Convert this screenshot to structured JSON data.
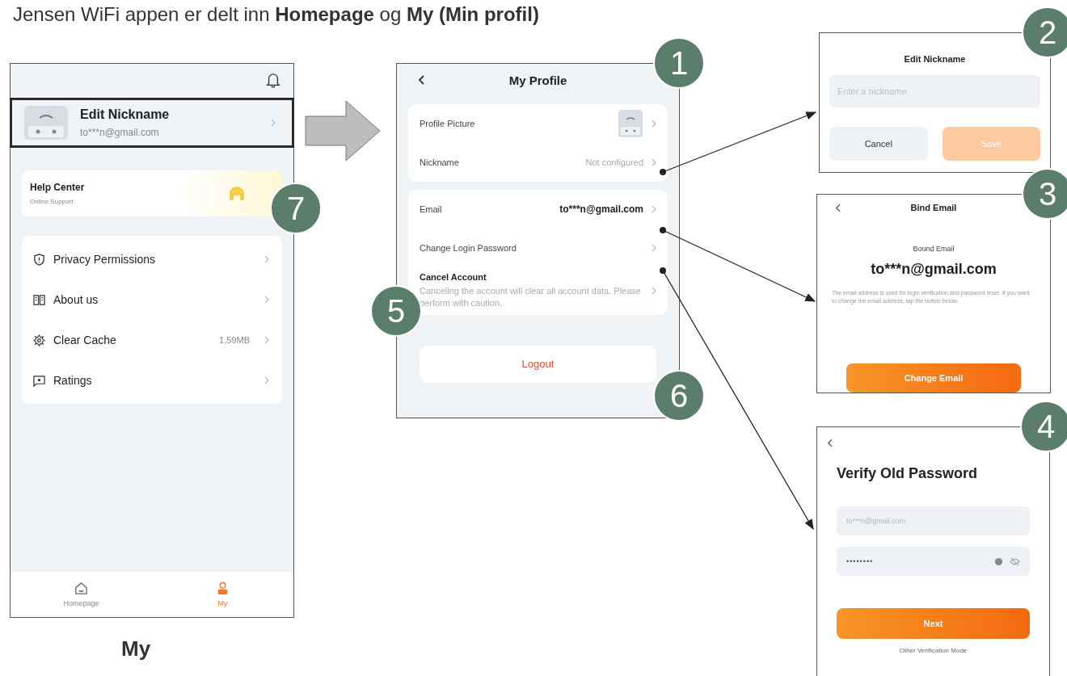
{
  "heading": "Jensen WiFi appen er delt inn **Homepage** og **My (Min profil)**",
  "my_screen": {
    "profile": {
      "name": "Edit Nickname",
      "email": "to***n@gmail.com"
    },
    "help": {
      "title": "Help Center",
      "subtitle": "Online Support"
    },
    "menu": [
      {
        "kind": "shield",
        "label": "Privacy Permissions"
      },
      {
        "kind": "book",
        "label": "About us"
      },
      {
        "kind": "cache",
        "label": "Clear Cache",
        "value": "1,59MB"
      },
      {
        "kind": "rating",
        "label": "Ratings"
      }
    ],
    "tabs": [
      {
        "kind": "home",
        "label": "Homepage",
        "selected": false
      },
      {
        "kind": "person",
        "label": "My",
        "selected": true
      }
    ],
    "caption": "My"
  },
  "profile_screen": {
    "title": "My Profile",
    "group_1": [
      {
        "kind": "avatar",
        "label": "Profile Picture"
      },
      {
        "kind": "value",
        "label": "Nickname",
        "value": "Not configured"
      }
    ],
    "group_2": [
      {
        "kind": "value",
        "label": "Email",
        "value": "to***n@gmail.com"
      },
      {
        "kind": "plain",
        "label": "Change Login Password"
      },
      {
        "kind": "note",
        "label": "Cancel Account",
        "note": "Canceling the account will clear all account data. Please perform with caution."
      }
    ],
    "logout": "Logout"
  },
  "nickname_dialog": {
    "title": "Edit Nickname",
    "placeholder": "Enter a nickname",
    "cancel": "Cancel",
    "save": "Save"
  },
  "bind_email": {
    "title": "Bind Email",
    "label": "Bound Email",
    "email": "to***n@gmail.com",
    "note": "The email address is used for login verification and password reset. If you want to change the email address, tap the button below.",
    "button": "Change Email"
  },
  "verify_password": {
    "title": "Verify Old Password",
    "account": "to***n@gmail.com",
    "password": "••••••••",
    "button": "Next",
    "link": "Other Verification Mode"
  },
  "badges": [
    "1",
    "2",
    "3",
    "4",
    "5",
    "6",
    "7"
  ]
}
